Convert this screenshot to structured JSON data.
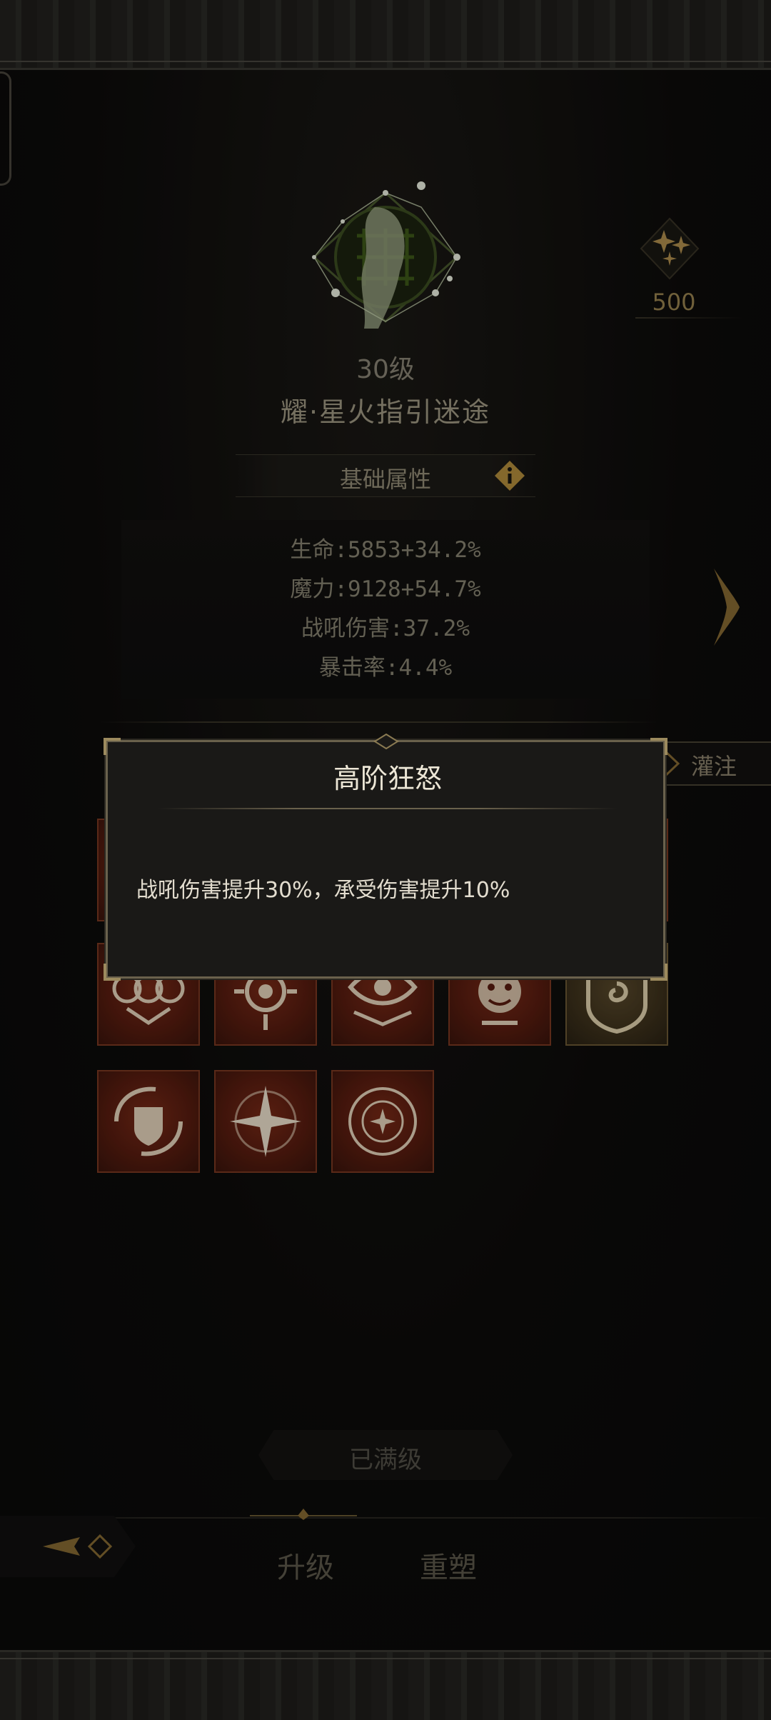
{
  "header": {
    "level": "30级",
    "skin_name": "耀·星火指引迷途"
  },
  "currency": {
    "icon": "sparkle-stars-icon",
    "value": "500"
  },
  "attributes": {
    "section_title": "基础属性",
    "items": [
      "生命:5853+34.2%",
      "魔力:9128+54.7%",
      "战吼伤害:37.2%",
      "暴击率:4.4%"
    ]
  },
  "actions": {
    "infuse_label": "灌注",
    "maxed_label": "已满级"
  },
  "tabs": [
    {
      "label": "升级",
      "active": true
    },
    {
      "label": "重塑",
      "active": false
    }
  ],
  "popup": {
    "title": "高阶狂怒",
    "description": "战吼伤害提升30%，承受伤害提升10%"
  },
  "talent_tiles": [
    {
      "icon": "rune-rage-icon",
      "tier": "red"
    },
    {
      "icon": "rune-claw-icon",
      "tier": "red"
    },
    {
      "icon": "rune-beast-icon",
      "tier": "red"
    },
    {
      "icon": "rune-fang-icon",
      "tier": "red"
    },
    {
      "icon": "rune-flame-icon",
      "tier": "red"
    },
    {
      "icon": "triple-wheel-icon",
      "tier": "red"
    },
    {
      "icon": "sun-eye-icon",
      "tier": "red"
    },
    {
      "icon": "winged-eye-icon",
      "tier": "red"
    },
    {
      "icon": "grinning-mask-icon",
      "tier": "red"
    },
    {
      "icon": "spiral-crest-icon",
      "tier": "gold"
    },
    {
      "icon": "shield-vortex-icon",
      "tier": "red"
    },
    {
      "icon": "four-point-star-icon",
      "tier": "red"
    },
    {
      "icon": "orbit-star-icon",
      "tier": "red"
    }
  ],
  "colors": {
    "accent_gold": "#c9a45a",
    "tile_red": "#6b2314",
    "text_light": "#ece6d6"
  }
}
